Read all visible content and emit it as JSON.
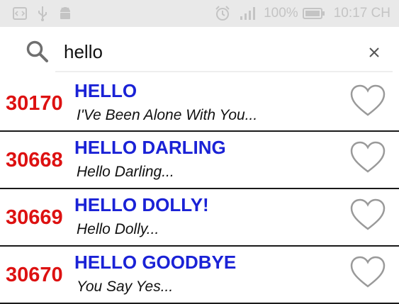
{
  "status_bar": {
    "icons": [
      "code-icon",
      "usb-icon",
      "android-icon",
      "alarm-icon",
      "signal-icon",
      "battery-icon"
    ],
    "battery_percent": "100%",
    "time": "10:17 CH"
  },
  "search": {
    "value": "hello",
    "icon": "search-icon",
    "clear_icon": "close-icon"
  },
  "results": [
    {
      "number": "30170",
      "title": "HELLO",
      "subtitle": "I'Ve Been Alone With You..."
    },
    {
      "number": "30668",
      "title": "HELLO DARLING",
      "subtitle": "Hello Darling..."
    },
    {
      "number": "30669",
      "title": "HELLO DOLLY!",
      "subtitle": "Hello Dolly..."
    },
    {
      "number": "30670",
      "title": "HELLO GOODBYE",
      "subtitle": "You Say Yes..."
    }
  ],
  "colors": {
    "number": "#dd1111",
    "title": "#1a22d6",
    "status_bar_bg": "#e9e9e9",
    "divider": "#1a1a1a"
  }
}
